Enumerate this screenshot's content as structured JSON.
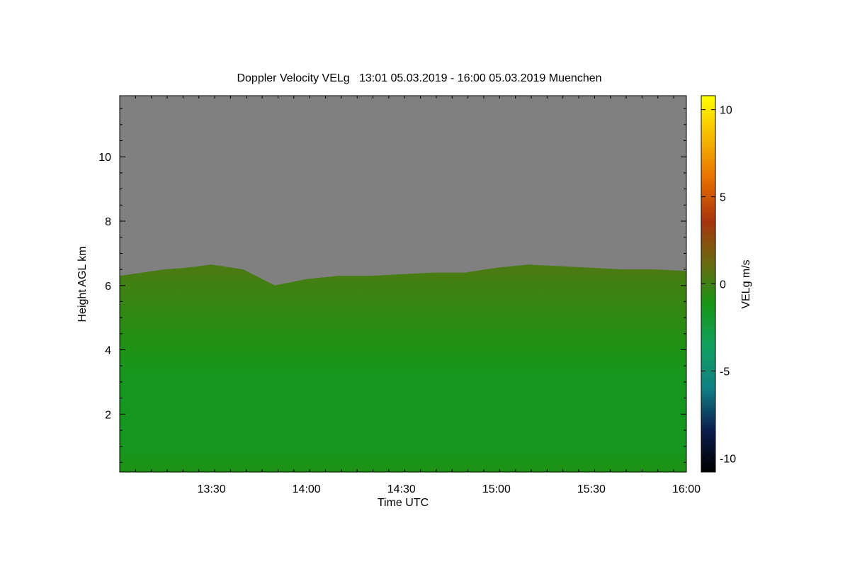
{
  "chart_data": {
    "type": "heatmap",
    "title": "Doppler Velocity VELg   13:01 05.03.2019 - 16:00 05.03.2019 Muenchen",
    "xlabel": "Time UTC",
    "ylabel": "Height AGL km",
    "xlim": [
      "13:01",
      "16:00"
    ],
    "ylim": [
      0.2,
      11.9
    ],
    "x_ticks": [
      "13:30",
      "14:00",
      "14:30",
      "15:00",
      "15:30",
      "16:00"
    ],
    "y_ticks": [
      "2",
      "4",
      "6",
      "8",
      "10"
    ],
    "colorbar": {
      "label": "VELg m/s",
      "range": [
        -10.8,
        10.8
      ],
      "ticks": [
        "10",
        "5",
        "0",
        "-5",
        "-10"
      ],
      "colors": [
        "#000000",
        "#0b1d4e",
        "#0f7f84",
        "#10a060",
        "#169616",
        "#6a6a10",
        "#a8340c",
        "#e66e00",
        "#f5b800",
        "#ffff00"
      ]
    },
    "background_color": "#808080",
    "cloud_top_km": {
      "time": [
        "13:01",
        "13:15",
        "13:22",
        "13:30",
        "13:40",
        "13:50",
        "14:00",
        "14:10",
        "14:20",
        "14:30",
        "14:40",
        "14:50",
        "15:00",
        "15:10",
        "15:20",
        "15:30",
        "15:40",
        "15:50",
        "16:00"
      ],
      "height": [
        6.3,
        6.5,
        6.55,
        6.65,
        6.5,
        6.0,
        6.2,
        6.3,
        6.3,
        6.35,
        6.4,
        6.4,
        6.55,
        6.65,
        6.6,
        6.55,
        6.5,
        6.5,
        6.45
      ]
    },
    "velocity_profile": {
      "height_km": [
        0.3,
        1.0,
        2.0,
        3.0,
        4.0,
        5.0,
        6.0,
        6.5
      ],
      "velocity_ms": [
        -1.0,
        -1.5,
        -1.5,
        -1.5,
        -1.0,
        -0.5,
        0.0,
        0.3
      ]
    }
  }
}
